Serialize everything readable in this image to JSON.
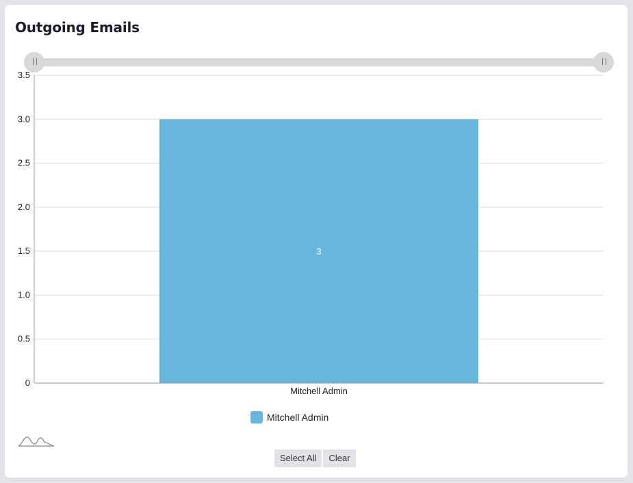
{
  "card": {
    "title": "Outgoing Emails"
  },
  "colors": {
    "bar": "#67b6dc",
    "grid": "#dddddd",
    "axis": "#999999"
  },
  "buttons": {
    "select_all": "Select All",
    "clear": "Clear"
  },
  "icons": {
    "range_handle": "grip-lines-icon",
    "sparkline": "sparkline-icon"
  },
  "chart_data": {
    "type": "bar",
    "categories": [
      "Mitchell Admin"
    ],
    "series": [
      {
        "name": "Mitchell Admin",
        "values": [
          3
        ],
        "color": "#67b6dc"
      }
    ],
    "data_labels": [
      "3"
    ],
    "yticks": [
      "0",
      "0.5",
      "1.0",
      "1.5",
      "2.0",
      "2.5",
      "3.0",
      "3.5"
    ],
    "ylim": [
      0,
      3.5
    ],
    "grid": true,
    "legend": "bottom-center",
    "range_selector": {
      "start": 0,
      "end": 1
    }
  }
}
